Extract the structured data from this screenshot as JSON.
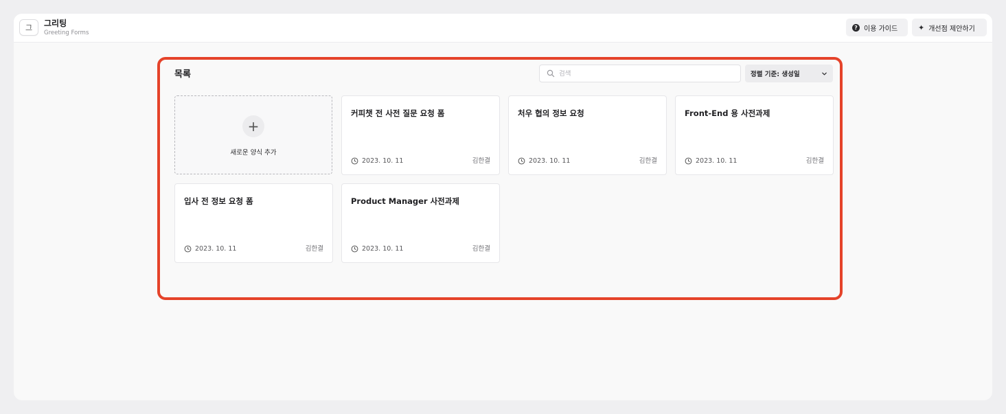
{
  "app": {
    "logo_letter": "그",
    "title": "그리팅",
    "subtitle": "Greeting Forms"
  },
  "toolbar": {
    "guide_label": "이용 가이드",
    "suggest_label": "개선점 제안하기"
  },
  "main": {
    "title": "목록",
    "search_placeholder": "검색",
    "sort_label": "정렬 기준: 생성일",
    "add_card_label": "새로운 양식 추가",
    "forms": [
      {
        "title": "커피챗 전 사전 질문 요청 폼",
        "date": "2023. 10. 11",
        "author": "김한결"
      },
      {
        "title": "처우 협의 정보 요청",
        "date": "2023. 10. 11",
        "author": "김한결"
      },
      {
        "title": "Front-End 용 사전과제",
        "date": "2023. 10. 11",
        "author": "김한결"
      },
      {
        "title": "입사 전 정보 요청 폼",
        "date": "2023. 10. 11",
        "author": "김한결"
      },
      {
        "title": "Product Manager 사전과제",
        "date": "2023. 10. 11",
        "author": "김한결"
      }
    ]
  },
  "colors": {
    "highlight": "#e5432a",
    "background": "#efeff1",
    "card": "#ffffff"
  }
}
